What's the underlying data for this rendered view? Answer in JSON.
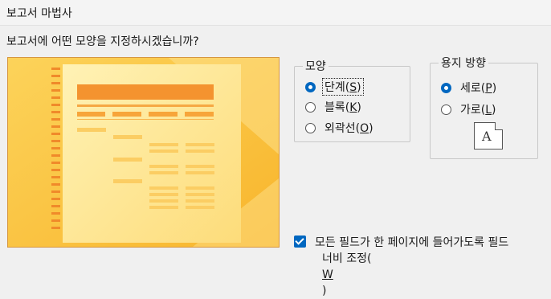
{
  "window": {
    "title": "보고서 마법사"
  },
  "prompt": "보고서에 어떤 모양을 지정하시겠습니까?",
  "layout_group": {
    "legend": "모양",
    "options": [
      {
        "pre": "단계(",
        "key": "S",
        "post": ")",
        "checked": true
      },
      {
        "pre": "블록(",
        "key": "K",
        "post": ")",
        "checked": false
      },
      {
        "pre": "외곽선(",
        "key": "O",
        "post": ")",
        "checked": false
      }
    ]
  },
  "orientation_group": {
    "legend": "용지 방향",
    "options": [
      {
        "pre": "세로(",
        "key": "P",
        "post": ")",
        "checked": true
      },
      {
        "pre": "가로(",
        "key": "L",
        "post": ")",
        "checked": false
      }
    ],
    "paper_letter": "A",
    "icon": "portrait-paper-icon"
  },
  "fit_fields": {
    "checked": true,
    "line1": "모든 필드가 한 페이지에 들어가도록 필드",
    "line2_pre": "너비 조정(",
    "line2_key": "W",
    "line2_post": ")"
  },
  "colors": {
    "accent": "#0067c0",
    "preview_bg": "#fbc43d",
    "preview_page": "#fde79a",
    "preview_bar": "#f4932f"
  }
}
